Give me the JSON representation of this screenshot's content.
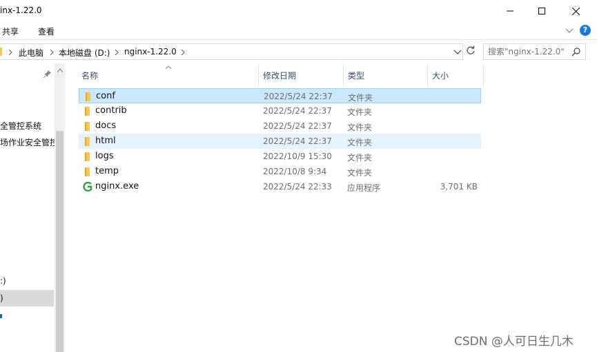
{
  "window": {
    "title": "inx-1.22.0"
  },
  "ribbon": {
    "tabs": [
      {
        "label": "共享"
      },
      {
        "label": "查看"
      }
    ],
    "help_label": "?"
  },
  "address": {
    "breadcrumbs": [
      {
        "label": "此电脑"
      },
      {
        "label": "本地磁盘 (D:)"
      },
      {
        "label": "nginx-1.22.0"
      }
    ]
  },
  "search": {
    "placeholder": "搜索\"nginx-1.22.0\""
  },
  "nav": {
    "items": [
      {
        "label": "全管控系统"
      },
      {
        "label": "场作业安全管控"
      },
      {
        "label": ":)"
      },
      {
        "label": ")"
      }
    ]
  },
  "list": {
    "columns": [
      {
        "label": "名称"
      },
      {
        "label": "修改日期"
      },
      {
        "label": "类型"
      },
      {
        "label": "大小"
      }
    ],
    "rows": [
      {
        "name": "conf",
        "date": "2022/5/24 22:37",
        "type": "文件夹",
        "size": "",
        "icon": "folder-icon",
        "state": "selected"
      },
      {
        "name": "contrib",
        "date": "2022/5/24 22:37",
        "type": "文件夹",
        "size": "",
        "icon": "folder-icon",
        "state": ""
      },
      {
        "name": "docs",
        "date": "2022/5/24 22:37",
        "type": "文件夹",
        "size": "",
        "icon": "folder-icon",
        "state": ""
      },
      {
        "name": "html",
        "date": "2022/5/24 22:37",
        "type": "文件夹",
        "size": "",
        "icon": "folder-icon",
        "state": "hover"
      },
      {
        "name": "logs",
        "date": "2022/10/9 15:30",
        "type": "文件夹",
        "size": "",
        "icon": "folder-icon",
        "state": ""
      },
      {
        "name": "temp",
        "date": "2022/10/8 9:34",
        "type": "文件夹",
        "size": "",
        "icon": "folder-icon",
        "state": ""
      },
      {
        "name": "nginx.exe",
        "date": "2022/5/24 22:33",
        "type": "应用程序",
        "size": "3,701 KB",
        "icon": "nginx-exe-icon",
        "state": ""
      }
    ]
  },
  "watermark": {
    "text": "CSDN @人可日生几木"
  },
  "colors": {
    "folder": "#f3c94f",
    "selected_bg": "#cce8ff",
    "hover_bg": "#e5f3ff",
    "nginx_green": "#2ea043",
    "help_blue": "#1c78d6"
  }
}
